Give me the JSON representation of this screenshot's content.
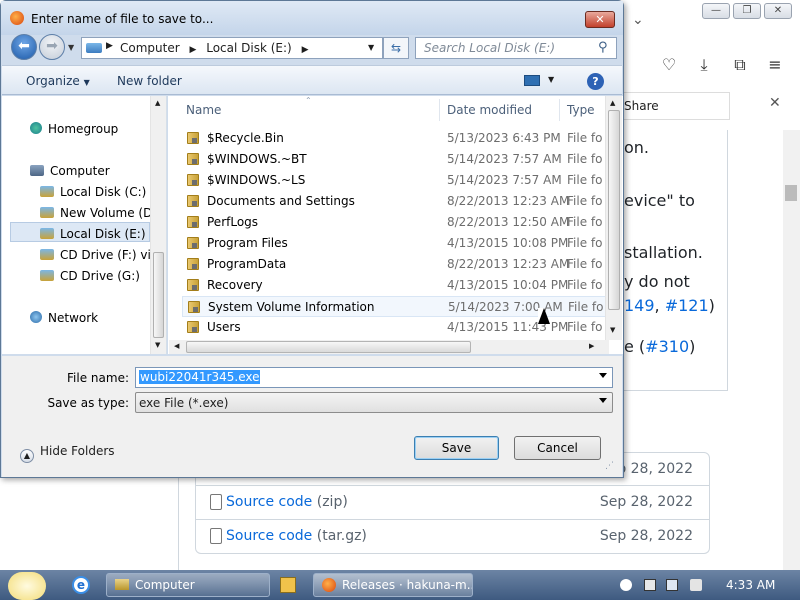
{
  "browser": {
    "share_label": "Share",
    "page_lines": [
      {
        "text": "on."
      },
      {
        "text": "evice\" to"
      },
      {
        "text": "stallation."
      },
      {
        "text": "y do not"
      },
      {
        "text": "e ("
      }
    ],
    "links": {
      "l1": "149",
      "l2": "#121",
      "l3": "#310"
    },
    "link_sep": ", ",
    "paren_close": ")",
    "assets": [
      {
        "name": "Source code",
        "ext": "(zip)",
        "date": "Sep 28, 2022"
      },
      {
        "name": "Source code",
        "ext": "(tar.gz)",
        "date": "Sep 28, 2022"
      }
    ],
    "partial_date": "ep 28, 2022"
  },
  "dialog": {
    "title": "Enter name of file to save to...",
    "address": {
      "crumbs": [
        "Computer",
        "Local Disk (E:)"
      ]
    },
    "search_placeholder": "Search Local Disk (E:)",
    "toolbar": {
      "organize": "Organize",
      "new_folder": "New folder"
    },
    "nav": {
      "homegroup": "Homegroup",
      "computer": "Computer",
      "drives": [
        "Local Disk (C:)",
        "New Volume (D:)",
        "Local Disk (E:)",
        "CD Drive (F:) virti",
        "CD Drive (G:)"
      ],
      "network": "Network"
    },
    "columns": {
      "name": "Name",
      "date": "Date modified",
      "type": "Type"
    },
    "files": [
      {
        "name": "$Recycle.Bin",
        "date": "5/13/2023 6:43 PM",
        "type": "File folder"
      },
      {
        "name": "$WINDOWS.~BT",
        "date": "5/14/2023 7:57 AM",
        "type": "File folder"
      },
      {
        "name": "$WINDOWS.~LS",
        "date": "5/14/2023 7:57 AM",
        "type": "File folder"
      },
      {
        "name": "Documents and Settings",
        "date": "8/22/2013 12:23 AM",
        "type": "File folder"
      },
      {
        "name": "PerfLogs",
        "date": "8/22/2013 12:50 AM",
        "type": "File folder"
      },
      {
        "name": "Program Files",
        "date": "4/13/2015 10:08 PM",
        "type": "File folder"
      },
      {
        "name": "ProgramData",
        "date": "8/22/2013 12:23 AM",
        "type": "File folder"
      },
      {
        "name": "Recovery",
        "date": "4/13/2015 10:04 PM",
        "type": "File folder"
      },
      {
        "name": "System Volume Information",
        "date": "5/14/2023 7:00 AM",
        "type": "File folder"
      },
      {
        "name": "Users",
        "date": "4/13/2015 11:43 PM",
        "type": "File folder"
      }
    ],
    "filename_label": "File name:",
    "filename_value": "wubi22041r345.exe",
    "savetype_label": "Save as type:",
    "savetype_value": "exe File (*.exe)",
    "hide_folders": "Hide Folders",
    "save": "Save",
    "cancel": "Cancel"
  },
  "taskbar": {
    "computer": "Computer",
    "releases": "Releases · hakuna-m...",
    "clock": "4:33 AM"
  }
}
